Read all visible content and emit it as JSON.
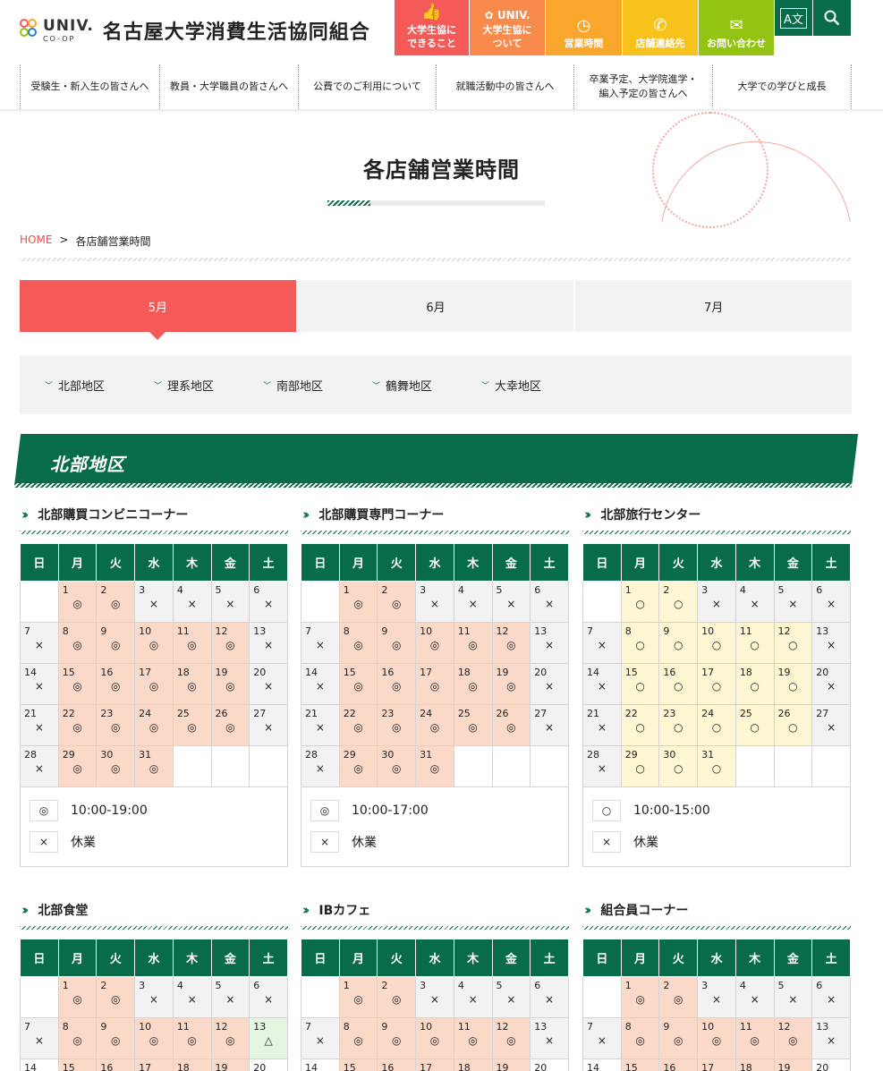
{
  "header": {
    "logo": {
      "univ": "UNIV.",
      "coop": "CO-OP"
    },
    "site_title": "名古屋大学消費生活協同組合",
    "buttons": [
      {
        "label": "大学生協に\nできること",
        "icon": "thumbs-up-icon",
        "color": "#f45a57"
      },
      {
        "label": "大学生協に\nついて",
        "icon": "univ-coop-icon",
        "color": "#f88a4c"
      },
      {
        "label": "営業時間",
        "icon": "clock-icon",
        "color": "#f8a62c"
      },
      {
        "label": "店舗連絡先",
        "icon": "phone-icon",
        "color": "#f7c21c"
      },
      {
        "label": "お問い合わせ",
        "icon": "mail-icon",
        "color": "#93c413"
      }
    ],
    "tools": [
      {
        "icon": "translate-icon"
      },
      {
        "icon": "search-icon"
      }
    ]
  },
  "nav": [
    "受験生・新入生の皆さんへ",
    "教員・大学職員の皆さんへ",
    "公費でのご利用について",
    "就職活動中の皆さんへ",
    "卒業予定、大学院進学・\n編入予定の皆さんへ",
    "大学での学びと成長"
  ],
  "page_title": "各店舗営業時間",
  "breadcrumb": {
    "home": "HOME",
    "sep": ">",
    "current": "各店舗営業時間"
  },
  "months": [
    "5月",
    "6月",
    "7月"
  ],
  "active_month": 0,
  "areas": [
    "北部地区",
    "理系地区",
    "南部地区",
    "鶴舞地区",
    "大幸地区"
  ],
  "section_title": "北部地区",
  "weekdays": [
    "日",
    "月",
    "火",
    "水",
    "木",
    "金",
    "土"
  ],
  "colors": {
    "green": "#086b4a",
    "red": "#f45a57",
    "peach": "#fbd9c8",
    "cream": "#fff6d3",
    "gray": "#f2f2f2",
    "mint": "#e4f6df"
  },
  "stores": [
    {
      "name": "北部購買コンビニコーナー",
      "offset": 1,
      "days": [
        "A",
        "A",
        "X",
        "X",
        "X",
        "X",
        "X",
        "A",
        "A",
        "A",
        "A",
        "A",
        "X",
        "X",
        "A",
        "A",
        "A",
        "A",
        "A",
        "X",
        "X",
        "A",
        "A",
        "A",
        "A",
        "A",
        "X",
        "X",
        "A",
        "A",
        "A"
      ],
      "legend": [
        {
          "type": "A",
          "mark": "◎",
          "label": "10:00-19:00"
        },
        {
          "type": "X",
          "mark": "×",
          "label": "休業"
        }
      ]
    },
    {
      "name": "北部購買専門コーナー",
      "offset": 1,
      "days": [
        "A",
        "A",
        "X",
        "X",
        "X",
        "X",
        "X",
        "A",
        "A",
        "A",
        "A",
        "A",
        "X",
        "X",
        "A",
        "A",
        "A",
        "A",
        "A",
        "X",
        "X",
        "A",
        "A",
        "A",
        "A",
        "A",
        "X",
        "X",
        "A",
        "A",
        "A"
      ],
      "legend": [
        {
          "type": "A",
          "mark": "◎",
          "label": "10:00-17:00"
        },
        {
          "type": "X",
          "mark": "×",
          "label": "休業"
        }
      ]
    },
    {
      "name": "北部旅行センター",
      "offset": 1,
      "days": [
        "B",
        "B",
        "X",
        "X",
        "X",
        "X",
        "X",
        "B",
        "B",
        "B",
        "B",
        "B",
        "X",
        "X",
        "B",
        "B",
        "B",
        "B",
        "B",
        "X",
        "X",
        "B",
        "B",
        "B",
        "B",
        "B",
        "X",
        "X",
        "B",
        "B",
        "B"
      ],
      "legend": [
        {
          "type": "B",
          "mark": "○",
          "label": "10:00-15:00"
        },
        {
          "type": "X",
          "mark": "×",
          "label": "休業"
        }
      ]
    },
    {
      "name": "北部食堂",
      "offset": 1,
      "days": [
        "A",
        "A",
        "X",
        "X",
        "X",
        "X",
        "X",
        "A",
        "A",
        "A",
        "A",
        "A",
        "C",
        "?",
        "A",
        "A",
        "A",
        "A",
        "A",
        "?"
      ],
      "legend": []
    },
    {
      "name": "IBカフェ",
      "offset": 1,
      "days": [
        "A",
        "A",
        "X",
        "X",
        "X",
        "X",
        "X",
        "A",
        "A",
        "A",
        "A",
        "A",
        "X",
        "?",
        "A",
        "A",
        "A",
        "A",
        "A",
        "?"
      ],
      "legend": []
    },
    {
      "name": "組合員コーナー",
      "offset": 1,
      "days": [
        "A",
        "A",
        "X",
        "X",
        "X",
        "X",
        "X",
        "A",
        "A",
        "A",
        "A",
        "A",
        "X",
        "?",
        "A",
        "A",
        "A",
        "A",
        "A",
        "?"
      ],
      "legend": []
    }
  ],
  "marks": {
    "A": "◎",
    "B": "○",
    "X": "×",
    "C": "△",
    "?": ""
  }
}
